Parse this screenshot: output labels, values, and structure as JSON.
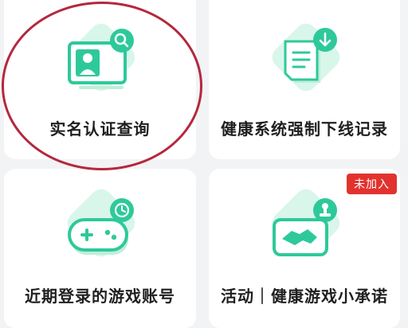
{
  "cards": [
    {
      "label": "实名认证查询",
      "icon": "id-card-search-icon"
    },
    {
      "label": "健康系统强制下线记录",
      "icon": "document-download-icon"
    },
    {
      "label": "近期登录的游戏账号",
      "icon": "gamepad-clock-icon"
    },
    {
      "label": "活动｜健康游戏小承诺",
      "icon": "handshake-stamp-icon",
      "badge": "未加入"
    }
  ],
  "colors": {
    "accent": "#2ec99a",
    "badge": "#e2322e",
    "highlight_ring": "#b4283e"
  }
}
